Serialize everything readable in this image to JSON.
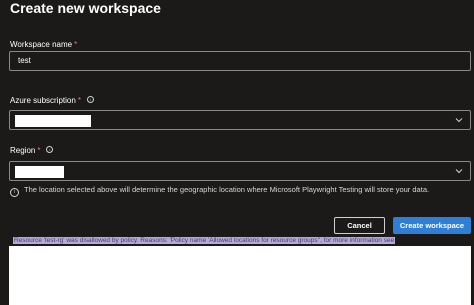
{
  "page": {
    "title": "Create new workspace"
  },
  "workspace_name": {
    "label": "Workspace name",
    "required_mark": "*",
    "value": "test"
  },
  "subscription": {
    "label": "Azure subscription",
    "required_mark": "*",
    "info_icon": "info-icon",
    "value": ""
  },
  "region": {
    "label": "Region",
    "required_mark": "*",
    "info_icon": "info-icon",
    "value": ""
  },
  "hint": {
    "icon": "info-icon",
    "text": "The location selected above will determine the geographic location where Microsoft Playwright Testing will store your data."
  },
  "buttons": {
    "cancel": "Cancel",
    "create": "Create workspace"
  },
  "error": {
    "text": "Resource 'test-rg' was disallowed by policy. Reasons: 'Policy name 'Allowed locations for resource groups'', for more information see"
  },
  "colors": {
    "background": "#1b1a19",
    "primary": "#2f7fd6",
    "required": "#f1707b",
    "highlight": "#b5a9d6"
  }
}
